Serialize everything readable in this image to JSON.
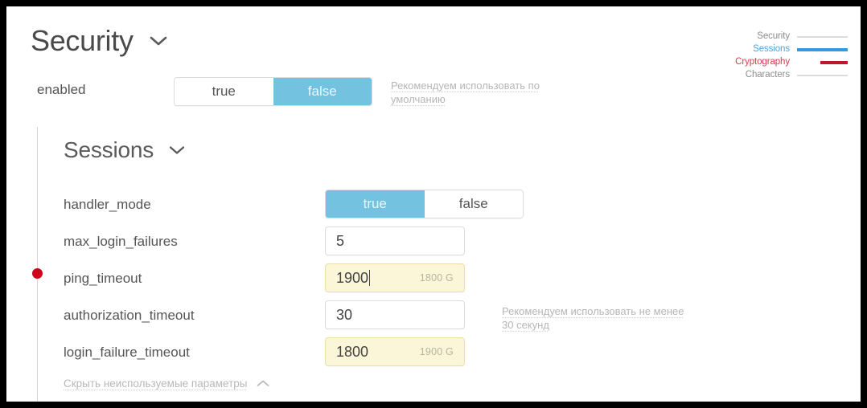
{
  "legend": {
    "items": [
      {
        "label": "Security",
        "color": "#8c8c8c",
        "bar": "gray",
        "bar_style": "full"
      },
      {
        "label": "Sessions",
        "color": "#4aa3df",
        "bar": "blue",
        "bar_style": "full"
      },
      {
        "label": "Cryptography",
        "color": "#d93a4b",
        "bar": "red",
        "bar_style": "short"
      },
      {
        "label": "Characters",
        "color": "#8c8c8c",
        "bar": "gray",
        "bar_style": "full"
      }
    ]
  },
  "security": {
    "title": "Security",
    "chevron_icon": "chevron-down-icon",
    "enabled": {
      "label": "enabled",
      "option_true": "true",
      "option_false": "false",
      "selected": "false",
      "hint": "Рекомендуем использовать по умолчанию"
    }
  },
  "sessions": {
    "title": "Sessions",
    "chevron_icon": "chevron-down-icon",
    "fields": [
      {
        "name": "handler_mode",
        "label": "handler_mode",
        "type": "toggle",
        "option_true": "true",
        "option_false": "false",
        "selected": "true",
        "hint": "",
        "modified": false,
        "marker": false
      },
      {
        "name": "max_login_failures",
        "label": "max_login_failures",
        "type": "input",
        "value": "5",
        "secondary": "",
        "hint": "",
        "modified": false,
        "marker": false
      },
      {
        "name": "ping_timeout",
        "label": "ping_timeout",
        "type": "input",
        "value": "1900",
        "secondary": "1800 G",
        "hint": "",
        "modified": true,
        "marker": true,
        "focused": true
      },
      {
        "name": "authorization_timeout",
        "label": "authorization_timeout",
        "type": "input",
        "value": "30",
        "secondary": "",
        "hint": "Рекомендуем использовать не менее 30 секунд",
        "modified": false,
        "marker": false
      },
      {
        "name": "login_failure_timeout",
        "label": "login_failure_timeout",
        "type": "input",
        "value": "1800",
        "secondary": "1900 G",
        "hint": "",
        "modified": true,
        "marker": false
      }
    ],
    "footer_link": {
      "label": "Скрыть неиспользуемые параметры",
      "chevron_icon": "chevron-up-icon"
    }
  },
  "colors": {
    "accent_blue": "#72c2e0",
    "legend_blue": "#3498db",
    "legend_red": "#c0172b",
    "marker_red": "#d0021b",
    "modified_bg": "#faf6d7"
  }
}
